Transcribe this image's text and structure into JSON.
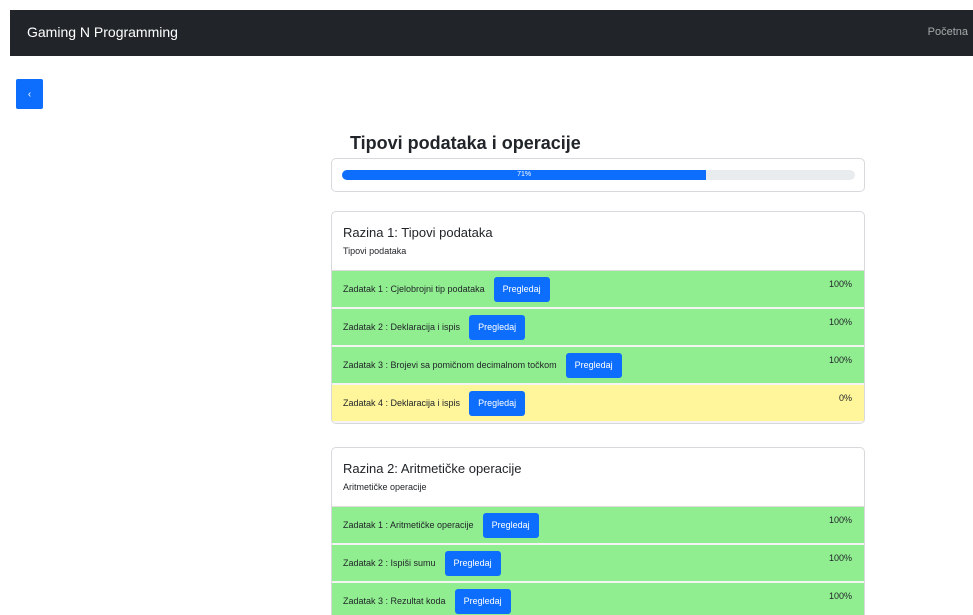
{
  "navbar": {
    "brand": "Gaming N Programming",
    "nav_link": "Početna"
  },
  "back_button": {
    "label": "‹"
  },
  "page_title": "Tipovi podataka i operacije",
  "progress": {
    "label": "71%",
    "value": 0.71
  },
  "levels": [
    {
      "title": "Razina 1: Tipovi podataka",
      "subtitle": "Tipovi podataka",
      "tasks": [
        {
          "label": "Zadatak 1 : Cjelobrojni tip podataka",
          "button": "Pregledaj",
          "percent": "100%",
          "status": "done"
        },
        {
          "label": "Zadatak 2 : Deklaracija i ispis",
          "button": "Pregledaj",
          "percent": "100%",
          "status": "done"
        },
        {
          "label": "Zadatak 3 : Brojevi sa pomičnom decimalnom točkom",
          "button": "Pregledaj",
          "percent": "100%",
          "status": "done"
        },
        {
          "label": "Zadatak 4 : Deklaracija i ispis",
          "button": "Pregledaj",
          "percent": "0%",
          "status": "todo"
        }
      ]
    },
    {
      "title": "Razina 2: Aritmetičke operacije",
      "subtitle": "Aritmetičke operacije",
      "tasks": [
        {
          "label": "Zadatak 1 : Aritmetičke operacije",
          "button": "Pregledaj",
          "percent": "100%",
          "status": "done"
        },
        {
          "label": "Zadatak 2 : Ispiši sumu",
          "button": "Pregledaj",
          "percent": "100%",
          "status": "done"
        },
        {
          "label": "Zadatak 3 : Rezultat koda",
          "button": "Pregledaj",
          "percent": "100%",
          "status": "done"
        }
      ]
    }
  ],
  "colors": {
    "navbar": "#212529",
    "primary": "#0d6efd",
    "task_done": "#90ee90",
    "task_todo": "#fff59a"
  }
}
